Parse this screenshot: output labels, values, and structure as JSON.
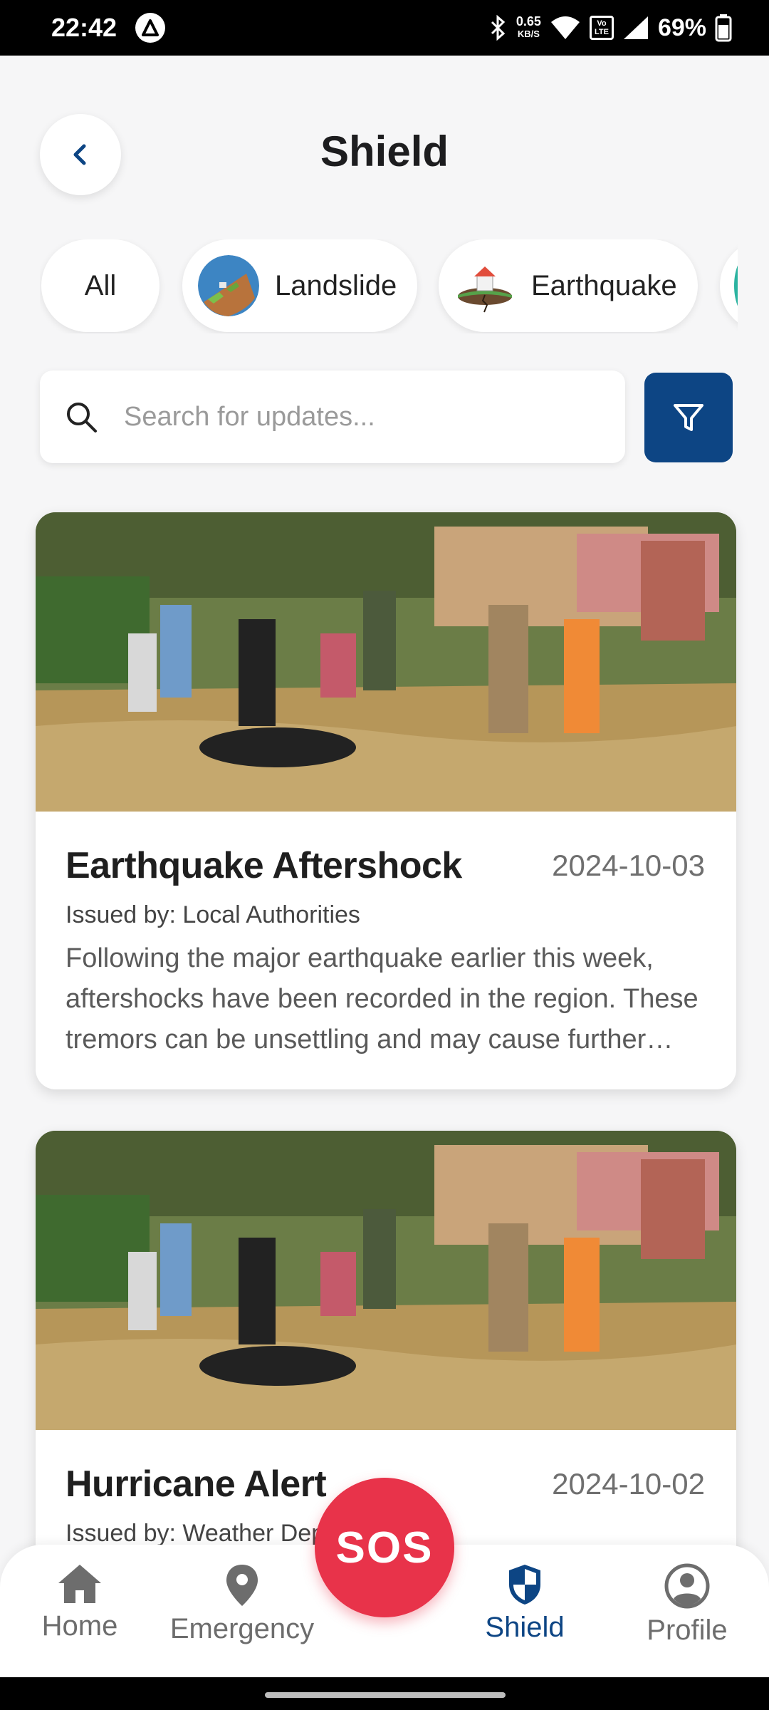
{
  "status_bar": {
    "time": "22:42",
    "net_speed_value": "0.65",
    "net_speed_unit": "KB/S",
    "volte_label": "Vo LTE",
    "battery": "69%"
  },
  "header": {
    "title": "Shield"
  },
  "categories": [
    {
      "label": "All",
      "icon": ""
    },
    {
      "label": "Landslide",
      "icon": "landslide-icon"
    },
    {
      "label": "Earthquake",
      "icon": "earthquake-icon"
    }
  ],
  "search": {
    "placeholder": "Search for updates..."
  },
  "updates": [
    {
      "title": "Earthquake Aftershock",
      "date": "2024-10-03",
      "issued_by": "Issued by: Local Authorities",
      "description": "Following the major earthquake earlier this week, aftershocks have been recorded in the region. These tremors can be unsettling and may cause further damage."
    },
    {
      "title": "Hurricane Alert",
      "date": "2024-10-02",
      "issued_by": "Issued by: Weather Department",
      "description": ""
    }
  ],
  "nav": {
    "home": "Home",
    "emergency": "Emergency",
    "sos": "SOS",
    "shield": "Shield",
    "profile": "Profile",
    "active": "shield"
  },
  "colors": {
    "primary": "#0d4584",
    "sos": "#e8334a",
    "background": "#f6f6f7"
  }
}
